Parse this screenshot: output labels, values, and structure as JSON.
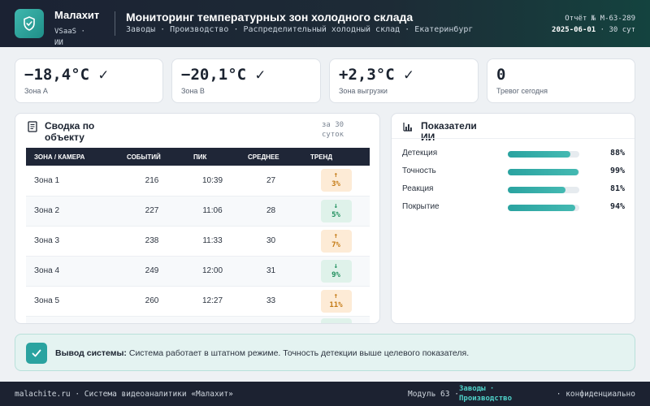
{
  "header": {
    "brand": "Малахит",
    "brand_sub": "VSaaS · ИИ",
    "title": "Мониторинг температурных зон холодного склада",
    "breadcrumbs": "Заводы · Производство · Распределительный холодный склад · Екатеринбург",
    "report_id": "Отчёт № M-63-289",
    "report_date": "2025-06-01",
    "report_period": " · 30 сут"
  },
  "kpis": [
    {
      "value": "−18,4°C ✓",
      "label": "Зона A"
    },
    {
      "value": "−20,1°C ✓",
      "label": "Зона B"
    },
    {
      "value": "+2,3°C ✓",
      "label": "Зона выгрузки"
    },
    {
      "value": "0",
      "label": "Тревог сегодня"
    }
  ],
  "summary": {
    "title": "Сводка по объекту",
    "period": "за 30 суток",
    "columns": [
      "ЗОНА / КАМЕРА",
      "СОБЫТИЙ",
      "ПИК",
      "СРЕДНЕЕ",
      "ТРЕНД"
    ],
    "rows": [
      {
        "zone": "Зона 1",
        "events": "216",
        "peak": "10:39",
        "avg": "27",
        "arrow": "↑",
        "trend": "3%",
        "dir": "up"
      },
      {
        "zone": "Зона 2",
        "events": "227",
        "peak": "11:06",
        "avg": "28",
        "arrow": "↓",
        "trend": "5%",
        "dir": "down"
      },
      {
        "zone": "Зона 3",
        "events": "238",
        "peak": "11:33",
        "avg": "30",
        "arrow": "↑",
        "trend": "7%",
        "dir": "up"
      },
      {
        "zone": "Зона 4",
        "events": "249",
        "peak": "12:00",
        "avg": "31",
        "arrow": "↓",
        "trend": "9%",
        "dir": "down"
      },
      {
        "zone": "Зона 5",
        "events": "260",
        "peak": "12:27",
        "avg": "33",
        "arrow": "↑",
        "trend": "11%",
        "dir": "up"
      }
    ]
  },
  "ai": {
    "title": "Показатели ИИ",
    "metrics": [
      {
        "label": "Детекция",
        "percent": 88,
        "value": "88%"
      },
      {
        "label": "Точность",
        "percent": 99,
        "value": "99%"
      },
      {
        "label": "Реакция",
        "percent": 81,
        "value": "81%"
      },
      {
        "label": "Покрытие",
        "percent": 94,
        "value": "94%"
      }
    ]
  },
  "banner": {
    "strong": "Вывод системы:",
    "text": " Система работает в штатном режиме. Точность детекции выше целевого показателя."
  },
  "footer": {
    "left": "malachite.ru · Система видеоаналитики «Малахит»",
    "module": "Модуль 63 ·",
    "tab": "Заводы · Производство",
    "right": "· конфиденциально"
  },
  "colors": {
    "accent": "#2aa3a0",
    "header_bg": "#1b2233",
    "trend_up": "#c47a14",
    "trend_down": "#1f8f5d"
  },
  "icons": {
    "logo": "shield-check-icon",
    "summary": "document-icon",
    "ai": "bar-chart-icon",
    "banner": "checkmark-icon"
  }
}
